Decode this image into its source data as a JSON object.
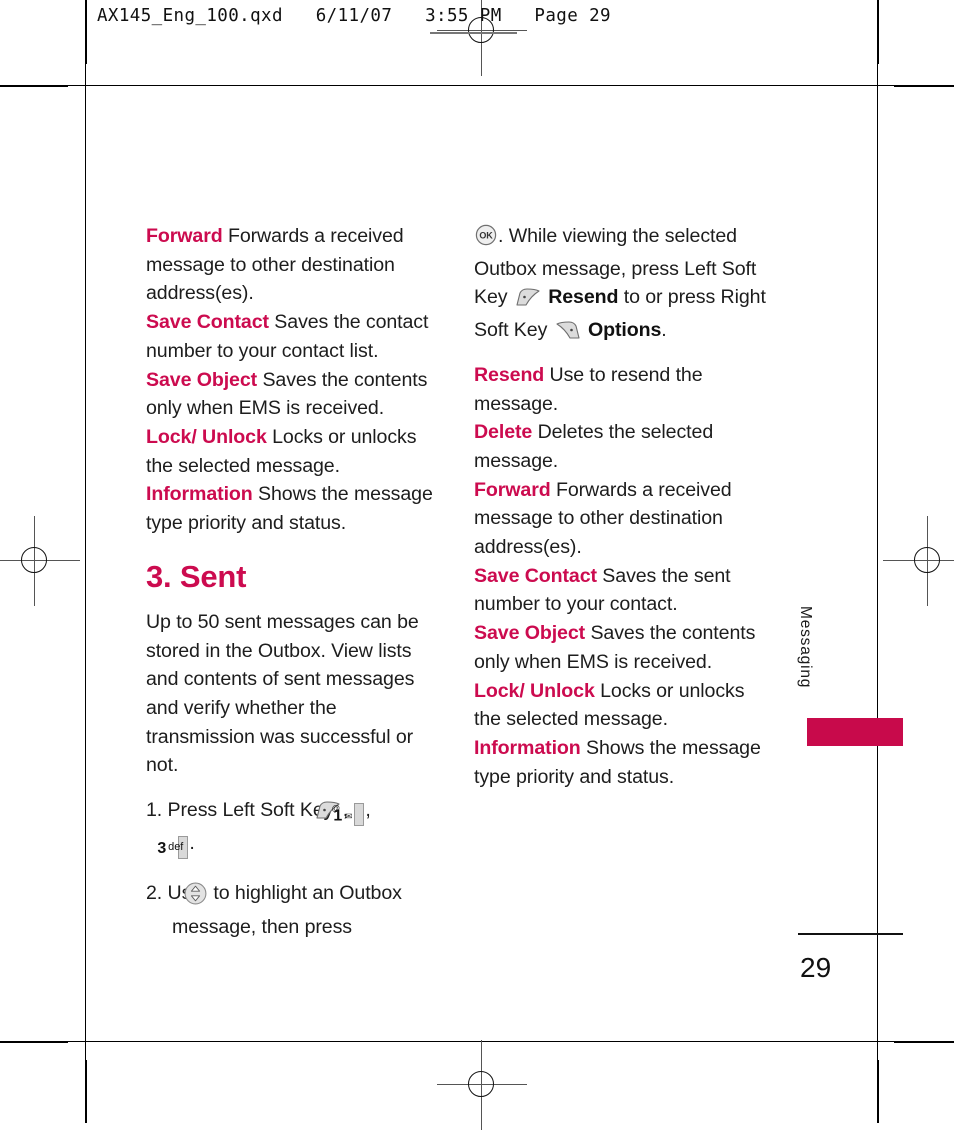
{
  "prepress": {
    "slug": "AX145_Eng_100.qxd   6/11/07   3:55 PM   Page 29"
  },
  "left_column": {
    "option_entries": [
      {
        "term": "Forward",
        "desc": "Forwards a received message to other destination address(es)."
      },
      {
        "term": "Save Contact",
        "desc": "Saves the contact number to your contact list."
      },
      {
        "term": "Save Object",
        "desc": "Saves the contents only when EMS is received."
      },
      {
        "term": "Lock/ Unlock",
        "desc": "Locks or unlocks the selected message."
      },
      {
        "term": "Information",
        "desc": "Shows the message type priority and status."
      }
    ],
    "section_heading": "3. Sent",
    "intro_paragraph": "Up to 50 sent messages can be stored in the Outbox. View lists and contents of sent messages and verify whether the transmission was successful or not.",
    "steps": [
      {
        "number": "1.",
        "part1": "Press Left Soft Key",
        "part2": ",",
        "part3": ",",
        "part4": "."
      },
      {
        "number": "2.",
        "part1": "Use",
        "part2": "to highlight an Outbox message, then press"
      }
    ]
  },
  "right_column": {
    "continuation": {
      "before": ". While viewing the selected Outbox message, press Left Soft Key",
      "bold1": "Resend",
      "middle": "to or press Right Soft Key",
      "bold2": "Options",
      "after": "."
    },
    "option_entries": [
      {
        "term": "Resend",
        "desc": "Use to resend the message."
      },
      {
        "term": "Delete",
        "desc": "Deletes the selected message."
      },
      {
        "term": "Forward",
        "desc": "Forwards a received message to other destination address(es)."
      },
      {
        "term": "Save Contact",
        "desc": "Saves the sent number to your contact."
      },
      {
        "term": "Save Object",
        "desc": "Saves the contents only when EMS is received."
      },
      {
        "term": "Lock/ Unlock",
        "desc": "Locks or unlocks the selected message."
      },
      {
        "term": "Information",
        "desc": "Shows the message type priority and status."
      }
    ]
  },
  "side_tab": {
    "label": "Messaging"
  },
  "folio": {
    "page_number": "29"
  },
  "icons": {
    "left_soft_key": "left-soft-key",
    "right_soft_key": "right-soft-key",
    "ok_key": "ok-key",
    "nav_updown_key": "nav-updown-key",
    "key_1": {
      "digit": "1",
      "top_glyph": "@",
      "bottom_glyph": "✉"
    },
    "key_3": {
      "digit": "3",
      "letters": "def"
    }
  },
  "colors": {
    "accent": "#CC0B4F",
    "tab_block": "#C80A4B",
    "body_text": "#1d1d1d",
    "keycap_fill": "#d9d9d9"
  }
}
